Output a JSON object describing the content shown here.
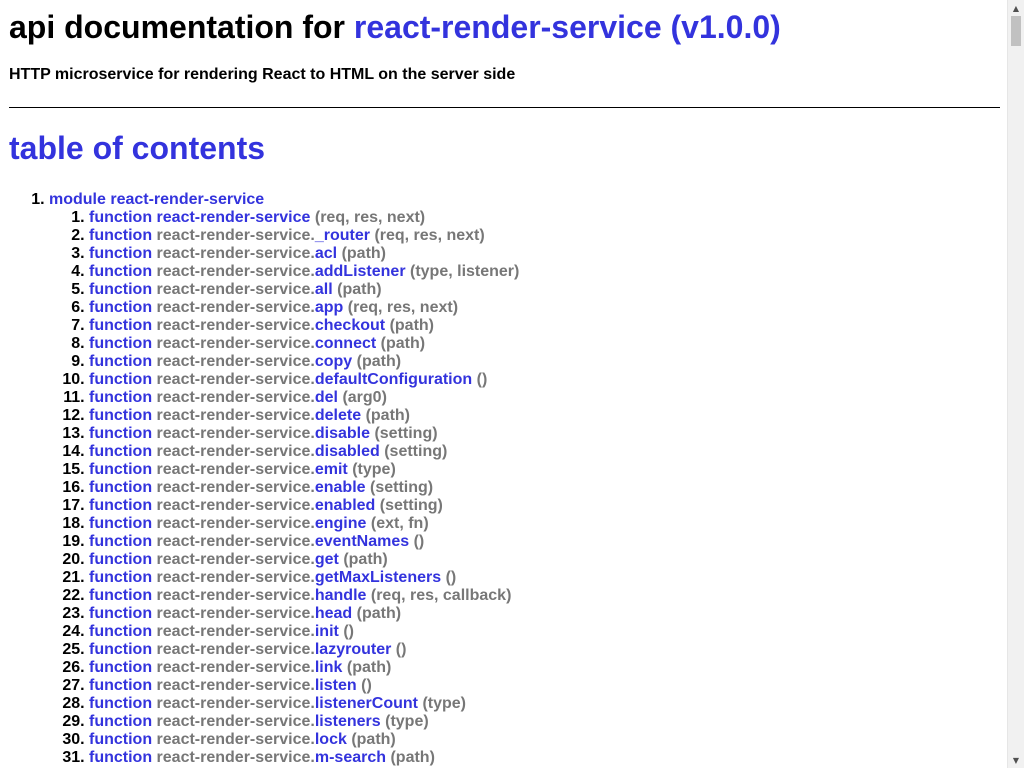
{
  "header": {
    "title_prefix": "api documentation for",
    "title_link": "react-render-service (v1.0.0)",
    "subtitle": "HTTP microservice for rendering React to HTML on the server side"
  },
  "toc": {
    "title": "table of contents",
    "module": {
      "label": "module react-render-service"
    },
    "items": [
      {
        "kw": "function",
        "ns": "",
        "name": "react-render-service",
        "args": "(req, res, next)"
      },
      {
        "kw": "function",
        "ns": "react-render-service.",
        "name": "_router",
        "args": "(req, res, next)"
      },
      {
        "kw": "function",
        "ns": "react-render-service.",
        "name": "acl",
        "args": "(path)"
      },
      {
        "kw": "function",
        "ns": "react-render-service.",
        "name": "addListener",
        "args": "(type, listener)"
      },
      {
        "kw": "function",
        "ns": "react-render-service.",
        "name": "all",
        "args": "(path)"
      },
      {
        "kw": "function",
        "ns": "react-render-service.",
        "name": "app",
        "args": "(req, res, next)"
      },
      {
        "kw": "function",
        "ns": "react-render-service.",
        "name": "checkout",
        "args": "(path)"
      },
      {
        "kw": "function",
        "ns": "react-render-service.",
        "name": "connect",
        "args": "(path)"
      },
      {
        "kw": "function",
        "ns": "react-render-service.",
        "name": "copy",
        "args": "(path)"
      },
      {
        "kw": "function",
        "ns": "react-render-service.",
        "name": "defaultConfiguration",
        "args": "()"
      },
      {
        "kw": "function",
        "ns": "react-render-service.",
        "name": "del",
        "args": "(arg0)"
      },
      {
        "kw": "function",
        "ns": "react-render-service.",
        "name": "delete",
        "args": "(path)"
      },
      {
        "kw": "function",
        "ns": "react-render-service.",
        "name": "disable",
        "args": "(setting)"
      },
      {
        "kw": "function",
        "ns": "react-render-service.",
        "name": "disabled",
        "args": "(setting)"
      },
      {
        "kw": "function",
        "ns": "react-render-service.",
        "name": "emit",
        "args": "(type)"
      },
      {
        "kw": "function",
        "ns": "react-render-service.",
        "name": "enable",
        "args": "(setting)"
      },
      {
        "kw": "function",
        "ns": "react-render-service.",
        "name": "enabled",
        "args": "(setting)"
      },
      {
        "kw": "function",
        "ns": "react-render-service.",
        "name": "engine",
        "args": "(ext, fn)"
      },
      {
        "kw": "function",
        "ns": "react-render-service.",
        "name": "eventNames",
        "args": "()"
      },
      {
        "kw": "function",
        "ns": "react-render-service.",
        "name": "get",
        "args": "(path)"
      },
      {
        "kw": "function",
        "ns": "react-render-service.",
        "name": "getMaxListeners",
        "args": "()"
      },
      {
        "kw": "function",
        "ns": "react-render-service.",
        "name": "handle",
        "args": "(req, res, callback)"
      },
      {
        "kw": "function",
        "ns": "react-render-service.",
        "name": "head",
        "args": "(path)"
      },
      {
        "kw": "function",
        "ns": "react-render-service.",
        "name": "init",
        "args": "()"
      },
      {
        "kw": "function",
        "ns": "react-render-service.",
        "name": "lazyrouter",
        "args": "()"
      },
      {
        "kw": "function",
        "ns": "react-render-service.",
        "name": "link",
        "args": "(path)"
      },
      {
        "kw": "function",
        "ns": "react-render-service.",
        "name": "listen",
        "args": "()"
      },
      {
        "kw": "function",
        "ns": "react-render-service.",
        "name": "listenerCount",
        "args": "(type)"
      },
      {
        "kw": "function",
        "ns": "react-render-service.",
        "name": "listeners",
        "args": "(type)"
      },
      {
        "kw": "function",
        "ns": "react-render-service.",
        "name": "lock",
        "args": "(path)"
      },
      {
        "kw": "function",
        "ns": "react-render-service.",
        "name": "m-search",
        "args": "(path)"
      }
    ]
  },
  "scrollbar": {
    "up_icon": "scroll-up-arrow",
    "down_icon": "scroll-down-arrow",
    "up_glyph": "▲",
    "down_glyph": "▼"
  },
  "colors": {
    "link": "#3333dd",
    "muted": "#777777",
    "text": "#000000"
  }
}
